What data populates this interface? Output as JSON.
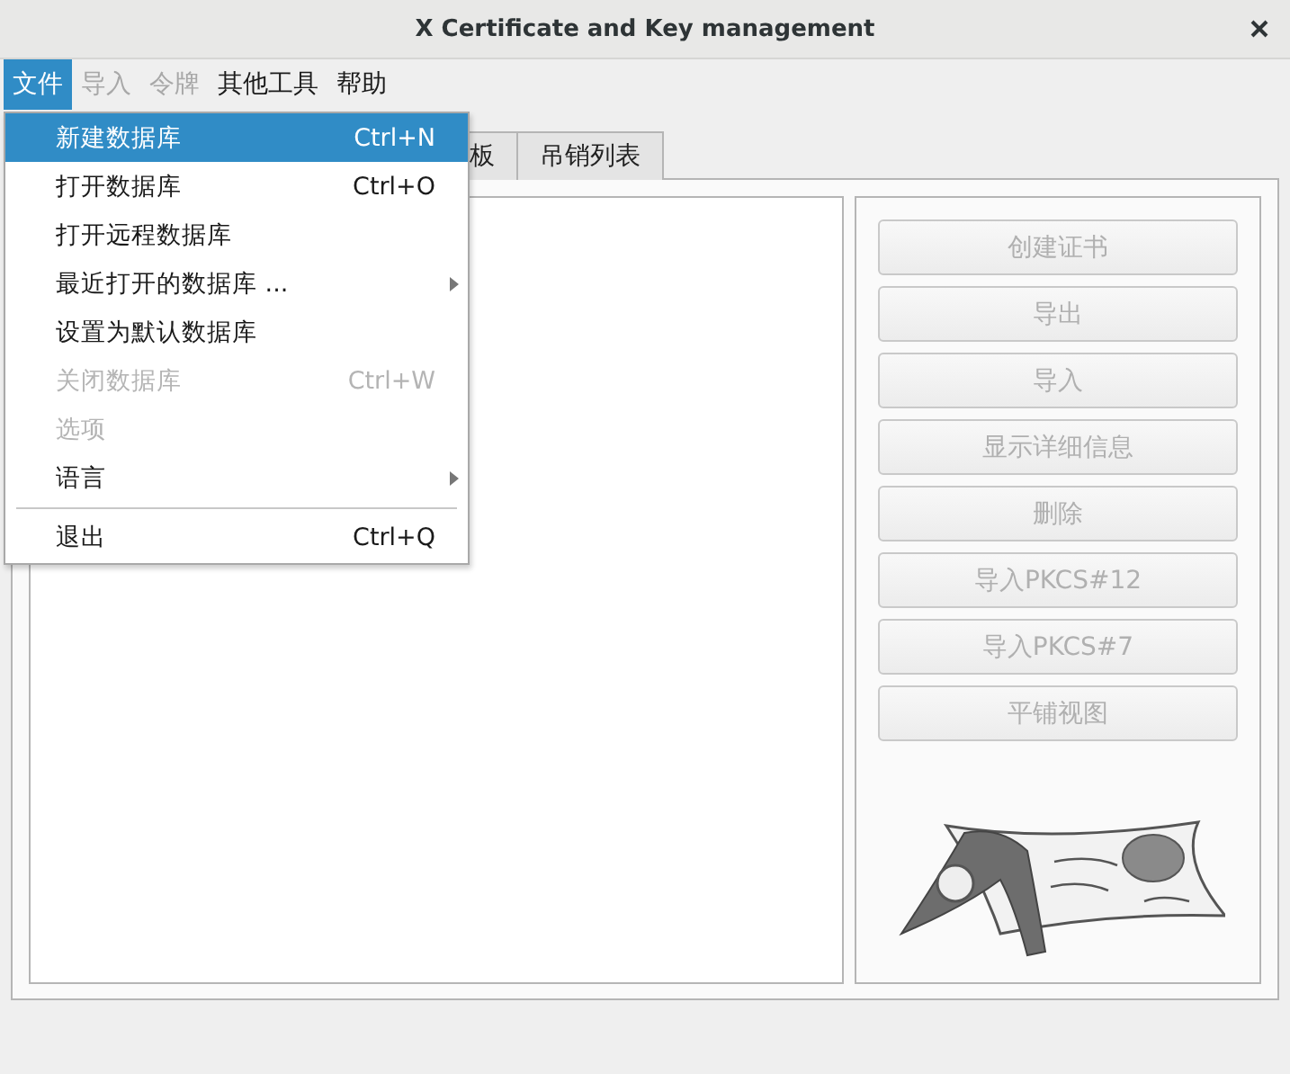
{
  "window": {
    "title": "X Certificate and Key management"
  },
  "menubar": [
    {
      "label": "文件",
      "disabled": false,
      "selected": true
    },
    {
      "label": "导入",
      "disabled": true,
      "selected": false
    },
    {
      "label": "令牌",
      "disabled": true,
      "selected": false
    },
    {
      "label": "其他工具",
      "disabled": false,
      "selected": false
    },
    {
      "label": "帮助",
      "disabled": false,
      "selected": false
    }
  ],
  "file_menu": [
    {
      "label": "新建数据库",
      "shortcut": "Ctrl+N",
      "selected": true,
      "disabled": false,
      "submenu": false,
      "separator_before": false
    },
    {
      "label": "打开数据库",
      "shortcut": "Ctrl+O",
      "selected": false,
      "disabled": false,
      "submenu": false,
      "separator_before": false
    },
    {
      "label": "打开远程数据库",
      "selected": false,
      "disabled": false,
      "submenu": false,
      "separator_before": false
    },
    {
      "label": "最近打开的数据库 ...",
      "selected": false,
      "disabled": false,
      "submenu": true,
      "separator_before": false
    },
    {
      "label": "设置为默认数据库",
      "selected": false,
      "disabled": false,
      "submenu": false,
      "separator_before": false
    },
    {
      "label": "关闭数据库",
      "shortcut": "Ctrl+W",
      "selected": false,
      "disabled": true,
      "submenu": false,
      "separator_before": false
    },
    {
      "label": "选项",
      "selected": false,
      "disabled": true,
      "submenu": false,
      "separator_before": false
    },
    {
      "label": "语言",
      "selected": false,
      "disabled": false,
      "submenu": true,
      "separator_before": false
    },
    {
      "label": "退出",
      "shortcut": "Ctrl+Q",
      "selected": false,
      "disabled": false,
      "submenu": false,
      "separator_before": true
    }
  ],
  "tabs": [
    {
      "label": "板",
      "selected": false
    },
    {
      "label": "吊销列表",
      "selected": false
    }
  ],
  "buttons": [
    {
      "label": "创建证书",
      "disabled": true
    },
    {
      "label": "导出",
      "disabled": true
    },
    {
      "label": "导入",
      "disabled": true
    },
    {
      "label": "显示详细信息",
      "disabled": true
    },
    {
      "label": "删除",
      "disabled": true
    },
    {
      "label": "导入PKCS#12",
      "disabled": true
    },
    {
      "label": "导入PKCS#7",
      "disabled": true
    },
    {
      "label": "平铺视图",
      "disabled": true
    }
  ]
}
